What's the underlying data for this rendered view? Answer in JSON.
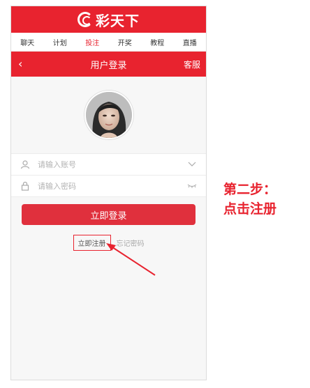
{
  "brand": {
    "name": "彩天下"
  },
  "nav_tabs": [
    {
      "label": "聊天"
    },
    {
      "label": "计划"
    },
    {
      "label": "投注"
    },
    {
      "label": "开奖"
    },
    {
      "label": "教程"
    },
    {
      "label": "直播"
    }
  ],
  "active_tab_index": 2,
  "header": {
    "back": "‹",
    "title": "用户登录",
    "service": "客服"
  },
  "form": {
    "account_placeholder": "请输入账号",
    "password_placeholder": "请输入密码"
  },
  "login_button": "立即登录",
  "register_link": "立即注册",
  "forgot_link": "忘记密码",
  "annotation": {
    "line1": "第二步：",
    "line2": "点击注册"
  },
  "colors": {
    "brand_red": "#e8232f",
    "annotation_red": "#e8232f"
  }
}
